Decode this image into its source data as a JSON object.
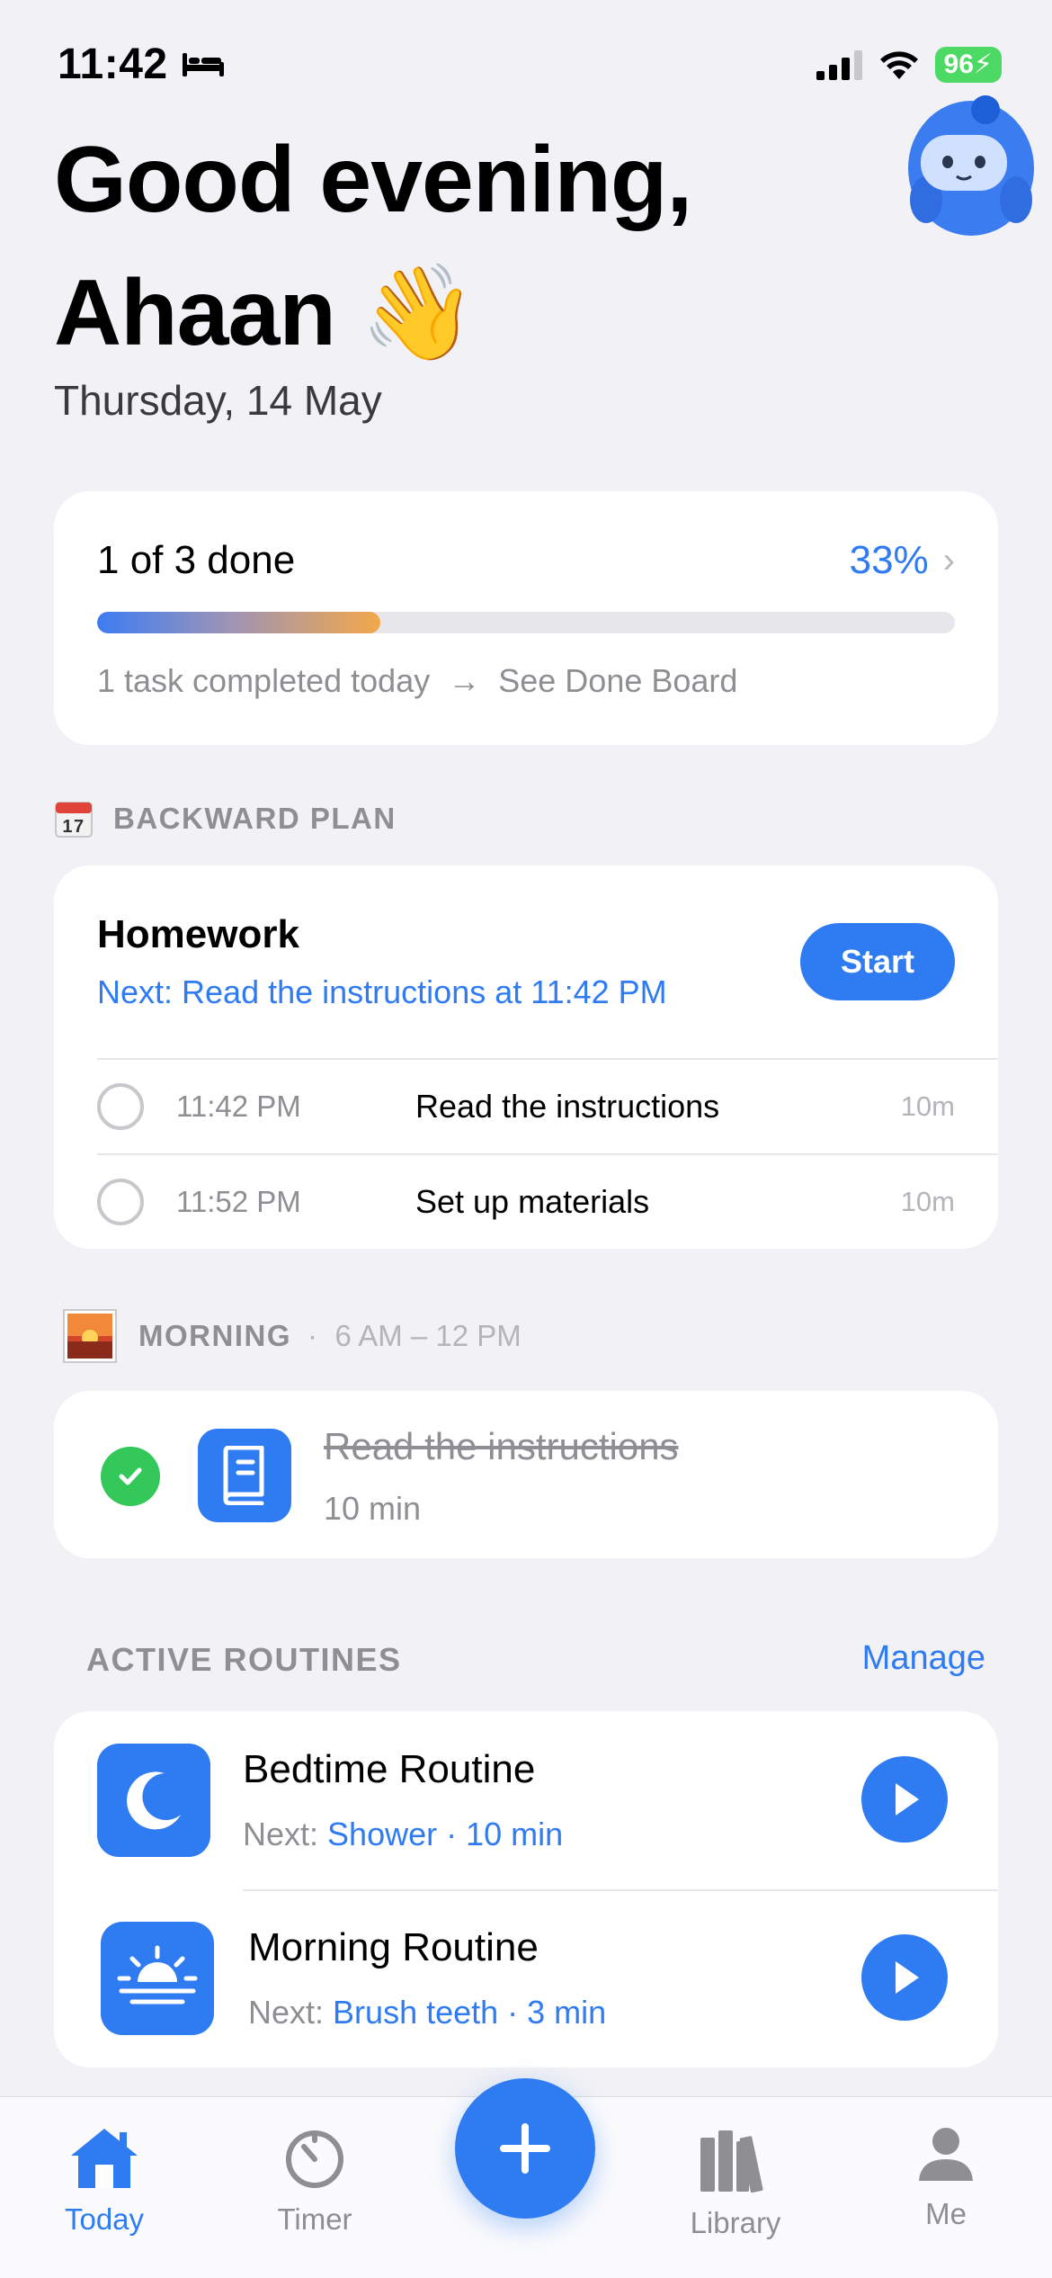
{
  "status_bar": {
    "time": "11:42",
    "battery": "96"
  },
  "header": {
    "greeting_line1": "Good evening,",
    "greeting_line2": "Ahaan 👋",
    "date": "Thursday, 14 May"
  },
  "progress": {
    "title": "1 of 3 done",
    "percent_label": "33%",
    "percent_value": 0.33,
    "subtitle": "1 task completed today",
    "link": "See Done Board"
  },
  "backward_plan": {
    "section_label": "BACKWARD PLAN",
    "calendar_day": "17",
    "title": "Homework",
    "next": "Next: Read the instructions at 11:42 PM",
    "start_label": "Start",
    "steps": [
      {
        "time": "11:42 PM",
        "task": "Read the instructions",
        "duration": "10m"
      },
      {
        "time": "11:52 PM",
        "task": "Set up materials",
        "duration": "10m"
      }
    ]
  },
  "morning": {
    "section_label": "MORNING",
    "range": "6 AM – 12 PM",
    "task": "Read the instructions",
    "duration": "10 min"
  },
  "routines": {
    "header": "ACTIVE ROUTINES",
    "manage_label": "Manage",
    "items": [
      {
        "title": "Bedtime Routine",
        "next_prefix": "Next:",
        "next_value": "Shower · 10 min",
        "icon": "moon-icon"
      },
      {
        "title": "Morning Routine",
        "next_prefix": "Next:",
        "next_value": "Brush teeth · 3 min",
        "icon": "sunrise-icon"
      }
    ]
  },
  "tabbar": {
    "today": "Today",
    "timer": "Timer",
    "library": "Library",
    "me": "Me"
  },
  "colors": {
    "accent": "#2f7bf2",
    "success": "#34c759",
    "orange": "#f3a84a"
  }
}
